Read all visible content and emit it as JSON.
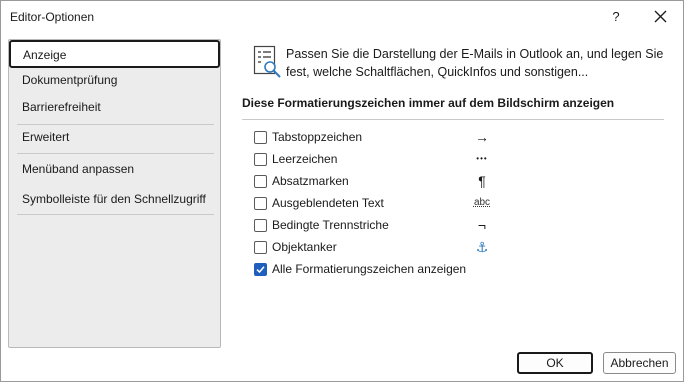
{
  "window": {
    "title": "Editor-Optionen",
    "help_label": "?"
  },
  "sidebar": {
    "items": [
      {
        "label": "Anzeige",
        "selected": true
      },
      {
        "label": "Dokumentprüfung"
      },
      {
        "label": "Barrierefreiheit"
      },
      {
        "label": "Erweitert"
      },
      {
        "label": "Menüband anpassen"
      },
      {
        "label": "Symbolleiste für den Schnellzugriff"
      }
    ]
  },
  "main": {
    "intro": "Passen Sie die Darstellung der E-Mails in Outlook an, und legen Sie fest, welche Schaltflächen, QuickInfos und sonstigen...",
    "section_heading": "Diese Formatierungszeichen immer auf dem Bildschirm anzeigen",
    "options": [
      {
        "label": "Tabstoppzeichen",
        "checked": false,
        "symbol": "→",
        "symbol_icon": "tab-arrow-icon"
      },
      {
        "label": "Leerzeichen",
        "checked": false,
        "symbol": "•••",
        "symbol_icon": "space-dots-icon"
      },
      {
        "label": "Absatzmarken",
        "checked": false,
        "symbol": "¶",
        "symbol_icon": "pilcrow-icon"
      },
      {
        "label": "Ausgeblendeten Text",
        "checked": false,
        "symbol": "abc",
        "symbol_icon": "hidden-text-icon"
      },
      {
        "label": "Bedingte Trennstriche",
        "checked": false,
        "symbol": "¬",
        "symbol_icon": "optional-hyphen-icon"
      },
      {
        "label": "Objektanker",
        "checked": false,
        "symbol": "⚓",
        "symbol_icon": "anchor-icon"
      },
      {
        "label": "Alle Formatierungszeichen anzeigen",
        "checked": true,
        "symbol": "",
        "symbol_icon": ""
      }
    ]
  },
  "buttons": {
    "ok": "OK",
    "cancel": "Abbrechen"
  },
  "colors": {
    "accent": "#1e5ebd",
    "sidebar_bg": "#ececec",
    "anchor": "#2f7bbf"
  }
}
